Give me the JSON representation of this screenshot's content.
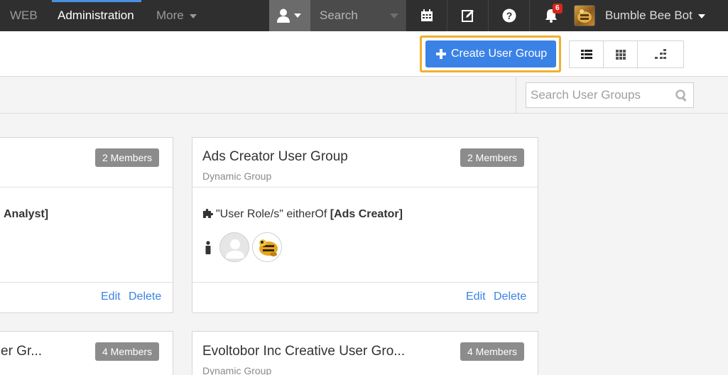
{
  "nav": {
    "web": "WEB",
    "administration": "Administration",
    "more": "More",
    "search": "Search",
    "notification_count": "6",
    "user_name": "Bumble Bee Bot"
  },
  "toolbar": {
    "create_label": "Create User Group"
  },
  "filter": {
    "search_placeholder": "Search User Groups"
  },
  "cards": {
    "c1": {
      "members": "2 Members",
      "rule_tail": "Analyst]",
      "edit": "Edit",
      "delete": "Delete"
    },
    "c2": {
      "title": "Ads Creator User Group",
      "subtitle": "Dynamic Group",
      "members": "2 Members",
      "rule_prefix": "\"User Role/s\" eitherOf ",
      "rule_value": "[Ads Creator]",
      "edit": "Edit",
      "delete": "Delete"
    },
    "c3": {
      "title": "er Gr...",
      "members": "4 Members"
    },
    "c4": {
      "title": "Evoltobor Inc Creative User Gro...",
      "subtitle": "Dynamic Group",
      "members": "4 Members"
    }
  },
  "colors": {
    "nav_bg": "#2f2f2f",
    "accent": "#3b82e6",
    "highlight": "#efb12f",
    "badge": "#d9261c"
  }
}
